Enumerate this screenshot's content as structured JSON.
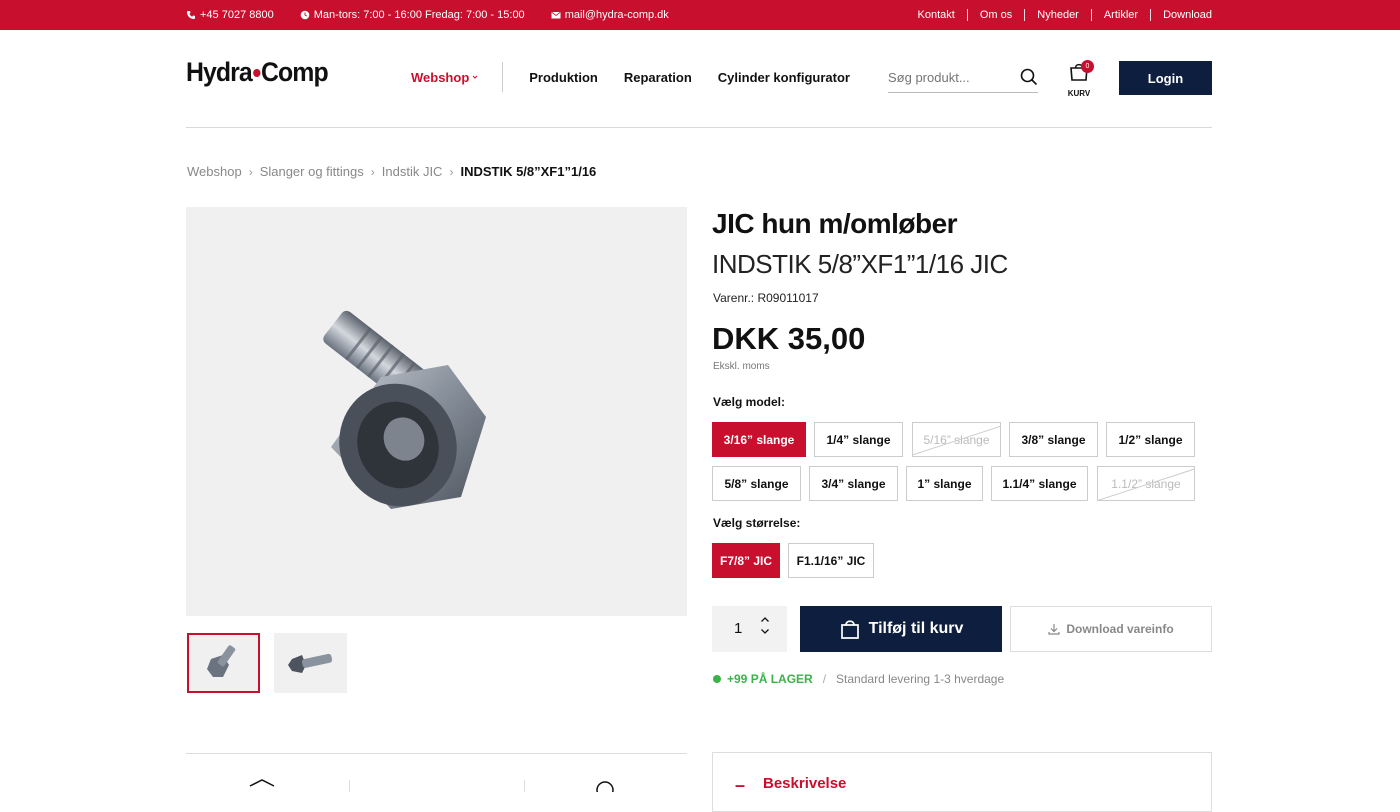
{
  "topbar": {
    "phone": "+45 7027 8800",
    "hours": "Man-tors: 7:00 - 16:00 Fredag: 7:00 - 15:00",
    "email": "mail@hydra-comp.dk",
    "links": [
      "Kontakt",
      "Om os",
      "Nyheder",
      "Artikler",
      "Download"
    ]
  },
  "header": {
    "logo_left": "Hydra",
    "logo_right": "Comp",
    "nav": {
      "webshop": "Webshop",
      "items": [
        "Produktion",
        "Reparation",
        "Cylinder konfigurator"
      ]
    },
    "search_placeholder": "Søg produkt...",
    "cart_label": "KURV",
    "cart_count": "0",
    "login_label": "Login"
  },
  "breadcrumb": [
    "Webshop",
    "Slanger og fittings",
    "Indstik JIC",
    "INDSTIK 5/8”XF1”1/16"
  ],
  "product": {
    "title": "JIC hun m/omløber",
    "subtitle": "INDSTIK 5/8”XF1”1/16 JIC",
    "sku": "Varenr.: R09011017",
    "price": "DKK 35,00",
    "vat_note": "Ekskl. moms",
    "model_label": "Vælg model:",
    "models": [
      {
        "label": "3/16” slange",
        "state": "selected"
      },
      {
        "label": "1/4” slange",
        "state": "available"
      },
      {
        "label": "5/16” slange",
        "state": "disabled"
      },
      {
        "label": "3/8” slange",
        "state": "available"
      },
      {
        "label": "1/2” slange",
        "state": "available"
      },
      {
        "label": "5/8” slange",
        "state": "available"
      },
      {
        "label": "3/4” slange",
        "state": "available"
      },
      {
        "label": "1” slange",
        "state": "available"
      },
      {
        "label": "1.1/4” slange",
        "state": "available"
      },
      {
        "label": "1.1/2” slange",
        "state": "disabled"
      }
    ],
    "size_label": "Vælg størrelse:",
    "sizes": [
      {
        "label": "F7/8” JIC",
        "state": "selected"
      },
      {
        "label": "F1.1/16” JIC",
        "state": "available"
      }
    ],
    "quantity": "1",
    "add_to_cart": "Tilføj til kurv",
    "download_info": "Download vareinfo",
    "stock": "+99 PÅ LAGER",
    "delivery": "Standard levering 1-3 hverdage"
  },
  "description": {
    "toggle": "–",
    "title": "Beskrivelse"
  },
  "colors": {
    "brand_red": "#c8102e",
    "navy": "#0e1e3e",
    "stock_green": "#3bb34a"
  },
  "icons": [
    "phone-icon",
    "clock-icon",
    "mail-icon",
    "search-icon",
    "cart-icon",
    "bag-icon",
    "download-icon",
    "chevron-up-icon",
    "chevron-down-icon"
  ]
}
